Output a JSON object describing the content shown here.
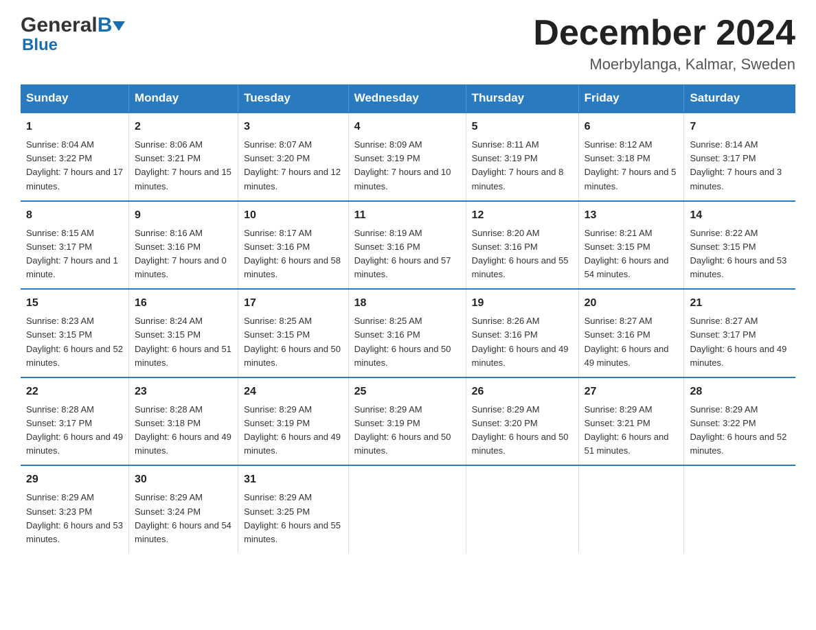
{
  "header": {
    "logo_general": "General",
    "logo_blue": "Blue",
    "month_title": "December 2024",
    "location": "Moerbylanga, Kalmar, Sweden"
  },
  "weekdays": [
    "Sunday",
    "Monday",
    "Tuesday",
    "Wednesday",
    "Thursday",
    "Friday",
    "Saturday"
  ],
  "weeks": [
    [
      {
        "day": "1",
        "sunrise": "8:04 AM",
        "sunset": "3:22 PM",
        "daylight": "7 hours and 17 minutes."
      },
      {
        "day": "2",
        "sunrise": "8:06 AM",
        "sunset": "3:21 PM",
        "daylight": "7 hours and 15 minutes."
      },
      {
        "day": "3",
        "sunrise": "8:07 AM",
        "sunset": "3:20 PM",
        "daylight": "7 hours and 12 minutes."
      },
      {
        "day": "4",
        "sunrise": "8:09 AM",
        "sunset": "3:19 PM",
        "daylight": "7 hours and 10 minutes."
      },
      {
        "day": "5",
        "sunrise": "8:11 AM",
        "sunset": "3:19 PM",
        "daylight": "7 hours and 8 minutes."
      },
      {
        "day": "6",
        "sunrise": "8:12 AM",
        "sunset": "3:18 PM",
        "daylight": "7 hours and 5 minutes."
      },
      {
        "day": "7",
        "sunrise": "8:14 AM",
        "sunset": "3:17 PM",
        "daylight": "7 hours and 3 minutes."
      }
    ],
    [
      {
        "day": "8",
        "sunrise": "8:15 AM",
        "sunset": "3:17 PM",
        "daylight": "7 hours and 1 minute."
      },
      {
        "day": "9",
        "sunrise": "8:16 AM",
        "sunset": "3:16 PM",
        "daylight": "7 hours and 0 minutes."
      },
      {
        "day": "10",
        "sunrise": "8:17 AM",
        "sunset": "3:16 PM",
        "daylight": "6 hours and 58 minutes."
      },
      {
        "day": "11",
        "sunrise": "8:19 AM",
        "sunset": "3:16 PM",
        "daylight": "6 hours and 57 minutes."
      },
      {
        "day": "12",
        "sunrise": "8:20 AM",
        "sunset": "3:16 PM",
        "daylight": "6 hours and 55 minutes."
      },
      {
        "day": "13",
        "sunrise": "8:21 AM",
        "sunset": "3:15 PM",
        "daylight": "6 hours and 54 minutes."
      },
      {
        "day": "14",
        "sunrise": "8:22 AM",
        "sunset": "3:15 PM",
        "daylight": "6 hours and 53 minutes."
      }
    ],
    [
      {
        "day": "15",
        "sunrise": "8:23 AM",
        "sunset": "3:15 PM",
        "daylight": "6 hours and 52 minutes."
      },
      {
        "day": "16",
        "sunrise": "8:24 AM",
        "sunset": "3:15 PM",
        "daylight": "6 hours and 51 minutes."
      },
      {
        "day": "17",
        "sunrise": "8:25 AM",
        "sunset": "3:15 PM",
        "daylight": "6 hours and 50 minutes."
      },
      {
        "day": "18",
        "sunrise": "8:25 AM",
        "sunset": "3:16 PM",
        "daylight": "6 hours and 50 minutes."
      },
      {
        "day": "19",
        "sunrise": "8:26 AM",
        "sunset": "3:16 PM",
        "daylight": "6 hours and 49 minutes."
      },
      {
        "day": "20",
        "sunrise": "8:27 AM",
        "sunset": "3:16 PM",
        "daylight": "6 hours and 49 minutes."
      },
      {
        "day": "21",
        "sunrise": "8:27 AM",
        "sunset": "3:17 PM",
        "daylight": "6 hours and 49 minutes."
      }
    ],
    [
      {
        "day": "22",
        "sunrise": "8:28 AM",
        "sunset": "3:17 PM",
        "daylight": "6 hours and 49 minutes."
      },
      {
        "day": "23",
        "sunrise": "8:28 AM",
        "sunset": "3:18 PM",
        "daylight": "6 hours and 49 minutes."
      },
      {
        "day": "24",
        "sunrise": "8:29 AM",
        "sunset": "3:19 PM",
        "daylight": "6 hours and 49 minutes."
      },
      {
        "day": "25",
        "sunrise": "8:29 AM",
        "sunset": "3:19 PM",
        "daylight": "6 hours and 50 minutes."
      },
      {
        "day": "26",
        "sunrise": "8:29 AM",
        "sunset": "3:20 PM",
        "daylight": "6 hours and 50 minutes."
      },
      {
        "day": "27",
        "sunrise": "8:29 AM",
        "sunset": "3:21 PM",
        "daylight": "6 hours and 51 minutes."
      },
      {
        "day": "28",
        "sunrise": "8:29 AM",
        "sunset": "3:22 PM",
        "daylight": "6 hours and 52 minutes."
      }
    ],
    [
      {
        "day": "29",
        "sunrise": "8:29 AM",
        "sunset": "3:23 PM",
        "daylight": "6 hours and 53 minutes."
      },
      {
        "day": "30",
        "sunrise": "8:29 AM",
        "sunset": "3:24 PM",
        "daylight": "6 hours and 54 minutes."
      },
      {
        "day": "31",
        "sunrise": "8:29 AM",
        "sunset": "3:25 PM",
        "daylight": "6 hours and 55 minutes."
      },
      null,
      null,
      null,
      null
    ]
  ]
}
